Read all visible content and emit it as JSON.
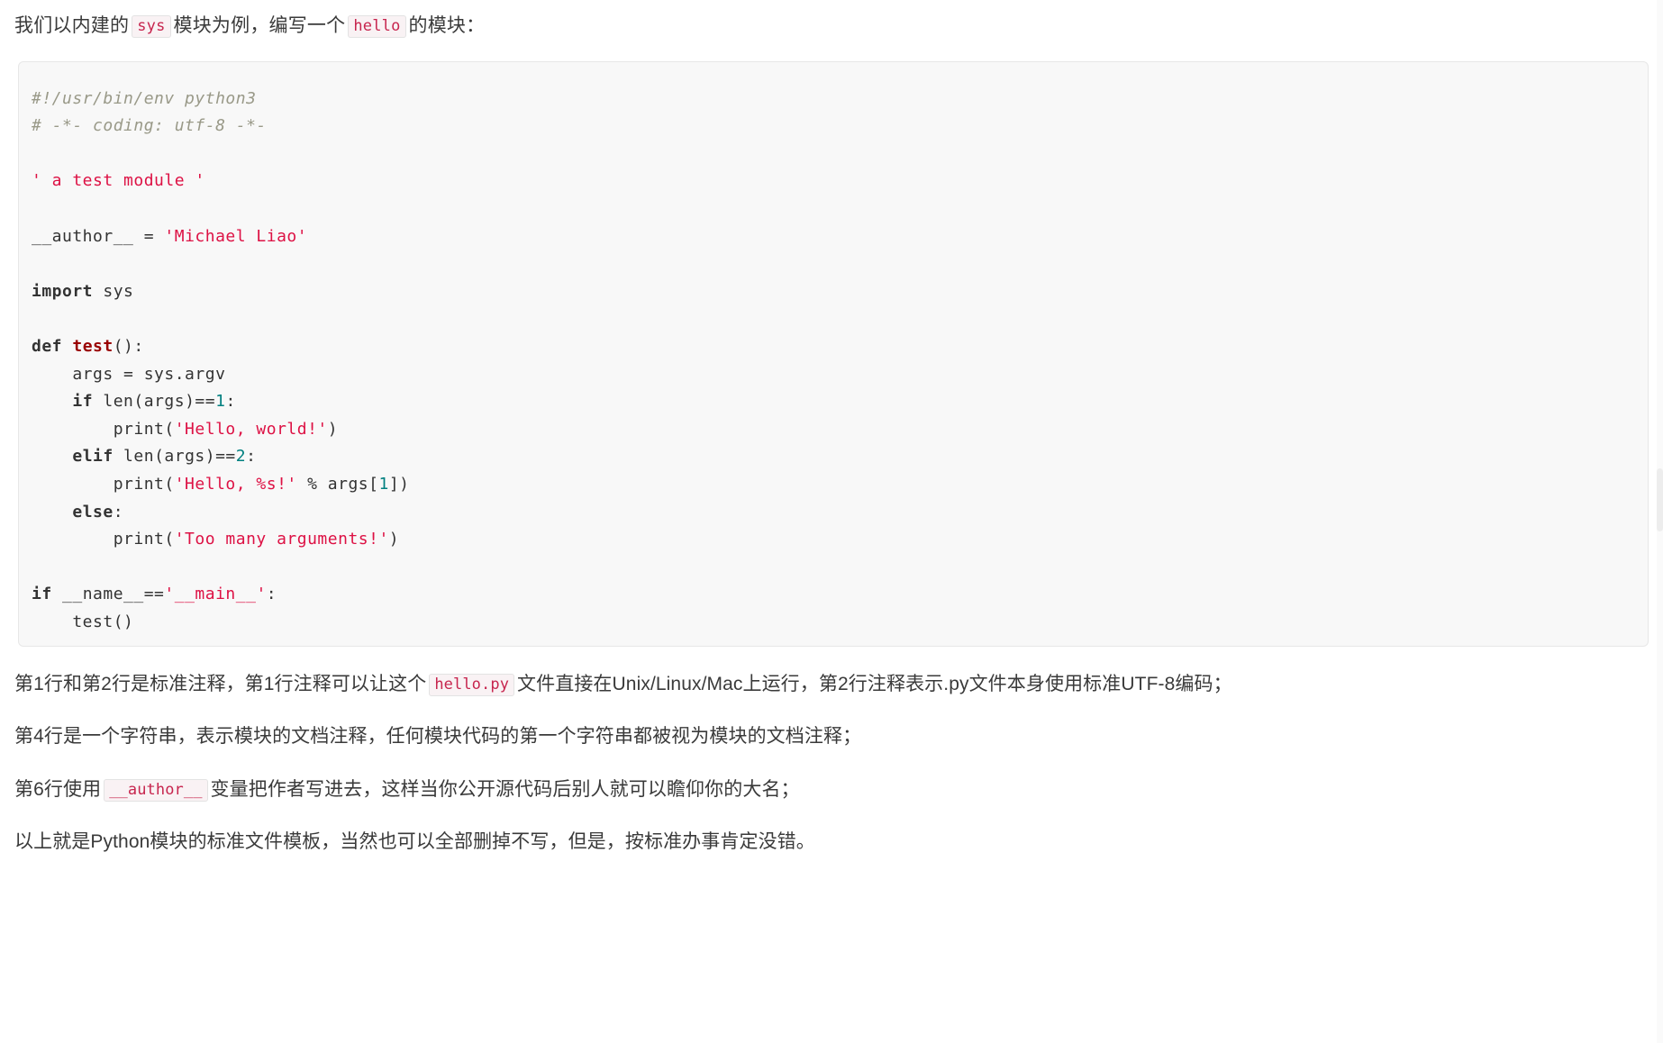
{
  "intro": {
    "part1": "我们以内建的",
    "chip1": "sys",
    "part2": "模块为例，编写一个",
    "chip2": "hello",
    "part3": "的模块："
  },
  "code": {
    "language": "python",
    "lines": [
      {
        "tokens": [
          {
            "t": "#!/usr/bin/env python3",
            "k": "comment"
          }
        ]
      },
      {
        "tokens": [
          {
            "t": "# -*- coding: utf-8 -*-",
            "k": "comment"
          }
        ]
      },
      {
        "tokens": []
      },
      {
        "tokens": [
          {
            "t": "' a test module '",
            "k": "string"
          }
        ]
      },
      {
        "tokens": []
      },
      {
        "tokens": [
          {
            "t": "__author__ = ",
            "k": "plain"
          },
          {
            "t": "'Michael Liao'",
            "k": "string"
          }
        ]
      },
      {
        "tokens": []
      },
      {
        "tokens": [
          {
            "t": "import",
            "k": "keyword"
          },
          {
            "t": " sys",
            "k": "plain"
          }
        ]
      },
      {
        "tokens": []
      },
      {
        "tokens": [
          {
            "t": "def ",
            "k": "keyword"
          },
          {
            "t": "test",
            "k": "func"
          },
          {
            "t": "():",
            "k": "plain"
          }
        ]
      },
      {
        "tokens": [
          {
            "t": "    args = sys.argv",
            "k": "plain"
          }
        ]
      },
      {
        "tokens": [
          {
            "t": "    ",
            "k": "plain"
          },
          {
            "t": "if",
            "k": "keyword"
          },
          {
            "t": " len(args)==",
            "k": "plain"
          },
          {
            "t": "1",
            "k": "number"
          },
          {
            "t": ":",
            "k": "plain"
          }
        ]
      },
      {
        "tokens": [
          {
            "t": "        print(",
            "k": "plain"
          },
          {
            "t": "'Hello, world!'",
            "k": "string"
          },
          {
            "t": ")",
            "k": "plain"
          }
        ]
      },
      {
        "tokens": [
          {
            "t": "    ",
            "k": "plain"
          },
          {
            "t": "elif",
            "k": "keyword"
          },
          {
            "t": " len(args)==",
            "k": "plain"
          },
          {
            "t": "2",
            "k": "number"
          },
          {
            "t": ":",
            "k": "plain"
          }
        ]
      },
      {
        "tokens": [
          {
            "t": "        print(",
            "k": "plain"
          },
          {
            "t": "'Hello, %s!'",
            "k": "string"
          },
          {
            "t": " % args[",
            "k": "plain"
          },
          {
            "t": "1",
            "k": "number"
          },
          {
            "t": "])",
            "k": "plain"
          }
        ]
      },
      {
        "tokens": [
          {
            "t": "    ",
            "k": "plain"
          },
          {
            "t": "else",
            "k": "keyword"
          },
          {
            "t": ":",
            "k": "plain"
          }
        ]
      },
      {
        "tokens": [
          {
            "t": "        print(",
            "k": "plain"
          },
          {
            "t": "'Too many arguments!'",
            "k": "string"
          },
          {
            "t": ")",
            "k": "plain"
          }
        ]
      },
      {
        "tokens": []
      },
      {
        "tokens": [
          {
            "t": "if",
            "k": "keyword"
          },
          {
            "t": " __name__==",
            "k": "plain"
          },
          {
            "t": "'__main__'",
            "k": "string"
          },
          {
            "t": ":",
            "k": "plain"
          }
        ]
      },
      {
        "tokens": [
          {
            "t": "    test()",
            "k": "plain"
          }
        ]
      }
    ]
  },
  "paragraphs": [
    {
      "part1": "第1行和第2行是标准注释，第1行注释可以让这个",
      "chip": "hello.py",
      "part2": "文件直接在Unix/Linux/Mac上运行，第2行注释表示.py文件本身使用标准UTF-8编码；"
    },
    {
      "part1": "第4行是一个字符串，表示模块的文档注释，任何模块代码的第一个字符串都被视为模块的文档注释；",
      "chip": "",
      "part2": ""
    },
    {
      "part1": "第6行使用",
      "chip": "__author__",
      "part2": "变量把作者写进去，这样当你公开源代码后别人就可以瞻仰你的大名；"
    },
    {
      "part1": "以上就是Python模块的标准文件模板，当然也可以全部删掉不写，但是，按标准办事肯定没错。",
      "chip": "",
      "part2": ""
    }
  ],
  "colors": {
    "string": "#d14",
    "comment": "#999988",
    "keyword": "#333333",
    "function": "#990000",
    "number": "#008080",
    "chip_text": "#c7254e",
    "chip_bg": "#f9f2f4",
    "code_bg": "#f8f8f8",
    "body_text": "#3a3a3a"
  }
}
